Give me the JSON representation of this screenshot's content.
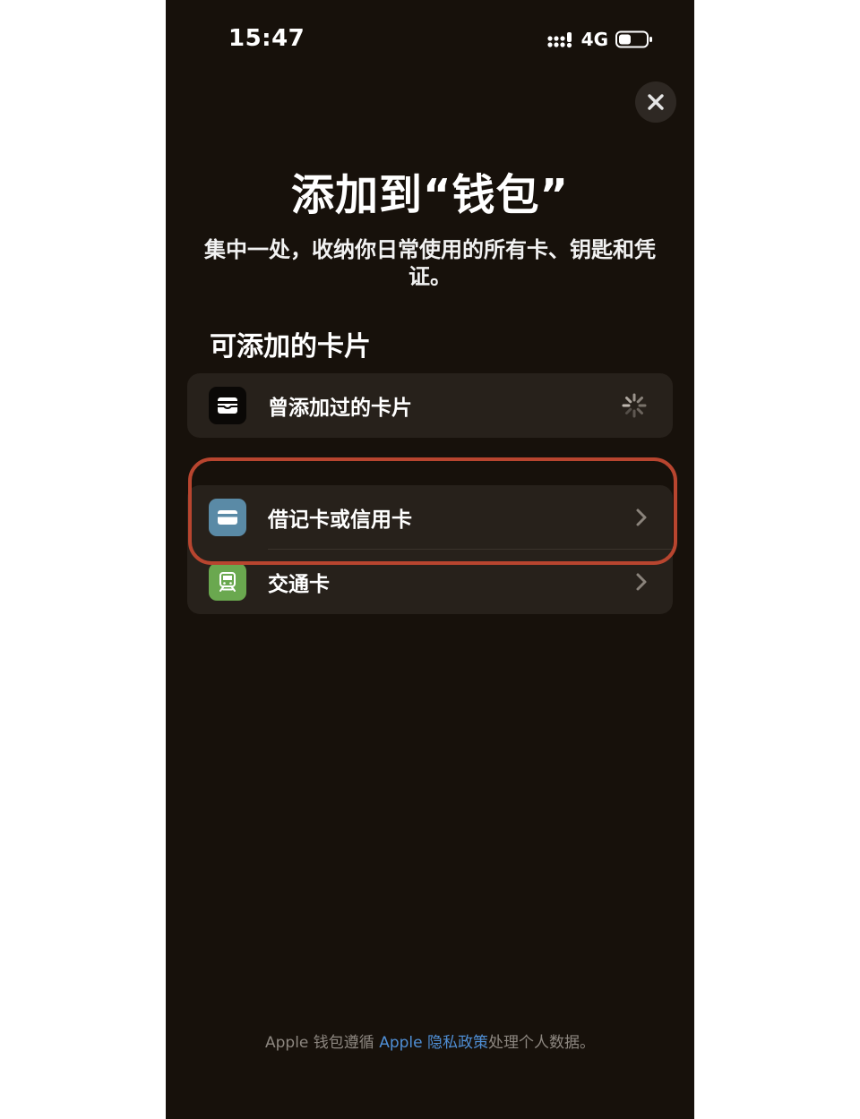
{
  "status_bar": {
    "time": "15:47",
    "network": "4G",
    "icons": [
      "signal-icon",
      "battery-icon"
    ]
  },
  "close": {
    "icon": "close-icon"
  },
  "header": {
    "title": "添加到“钱包”",
    "subtitle": "集中一处，收纳你日常使用的所有卡、钥匙和凭证。"
  },
  "section": {
    "title": "可添加的卡片"
  },
  "previous_cards": {
    "label": "曾添加过的卡片",
    "icon": "wallet-icon",
    "accessory": "loading-spinner-icon"
  },
  "add_options": [
    {
      "label": "借记卡或信用卡",
      "icon": "credit-card-icon",
      "accessory": "chevron-right-icon"
    },
    {
      "label": "交通卡",
      "icon": "train-icon",
      "accessory": "chevron-right-icon"
    }
  ],
  "footer": {
    "prefix": "Apple 钱包遵循 ",
    "link": "Apple 隐私政策",
    "suffix": "处理个人数据。"
  },
  "colors": {
    "background": "#17110b",
    "row_background": "#27211b",
    "highlight": "#b8452f",
    "link": "#4f8fd6",
    "credit_icon": "#5a8aa6",
    "transit_icon": "#6aa84f"
  }
}
